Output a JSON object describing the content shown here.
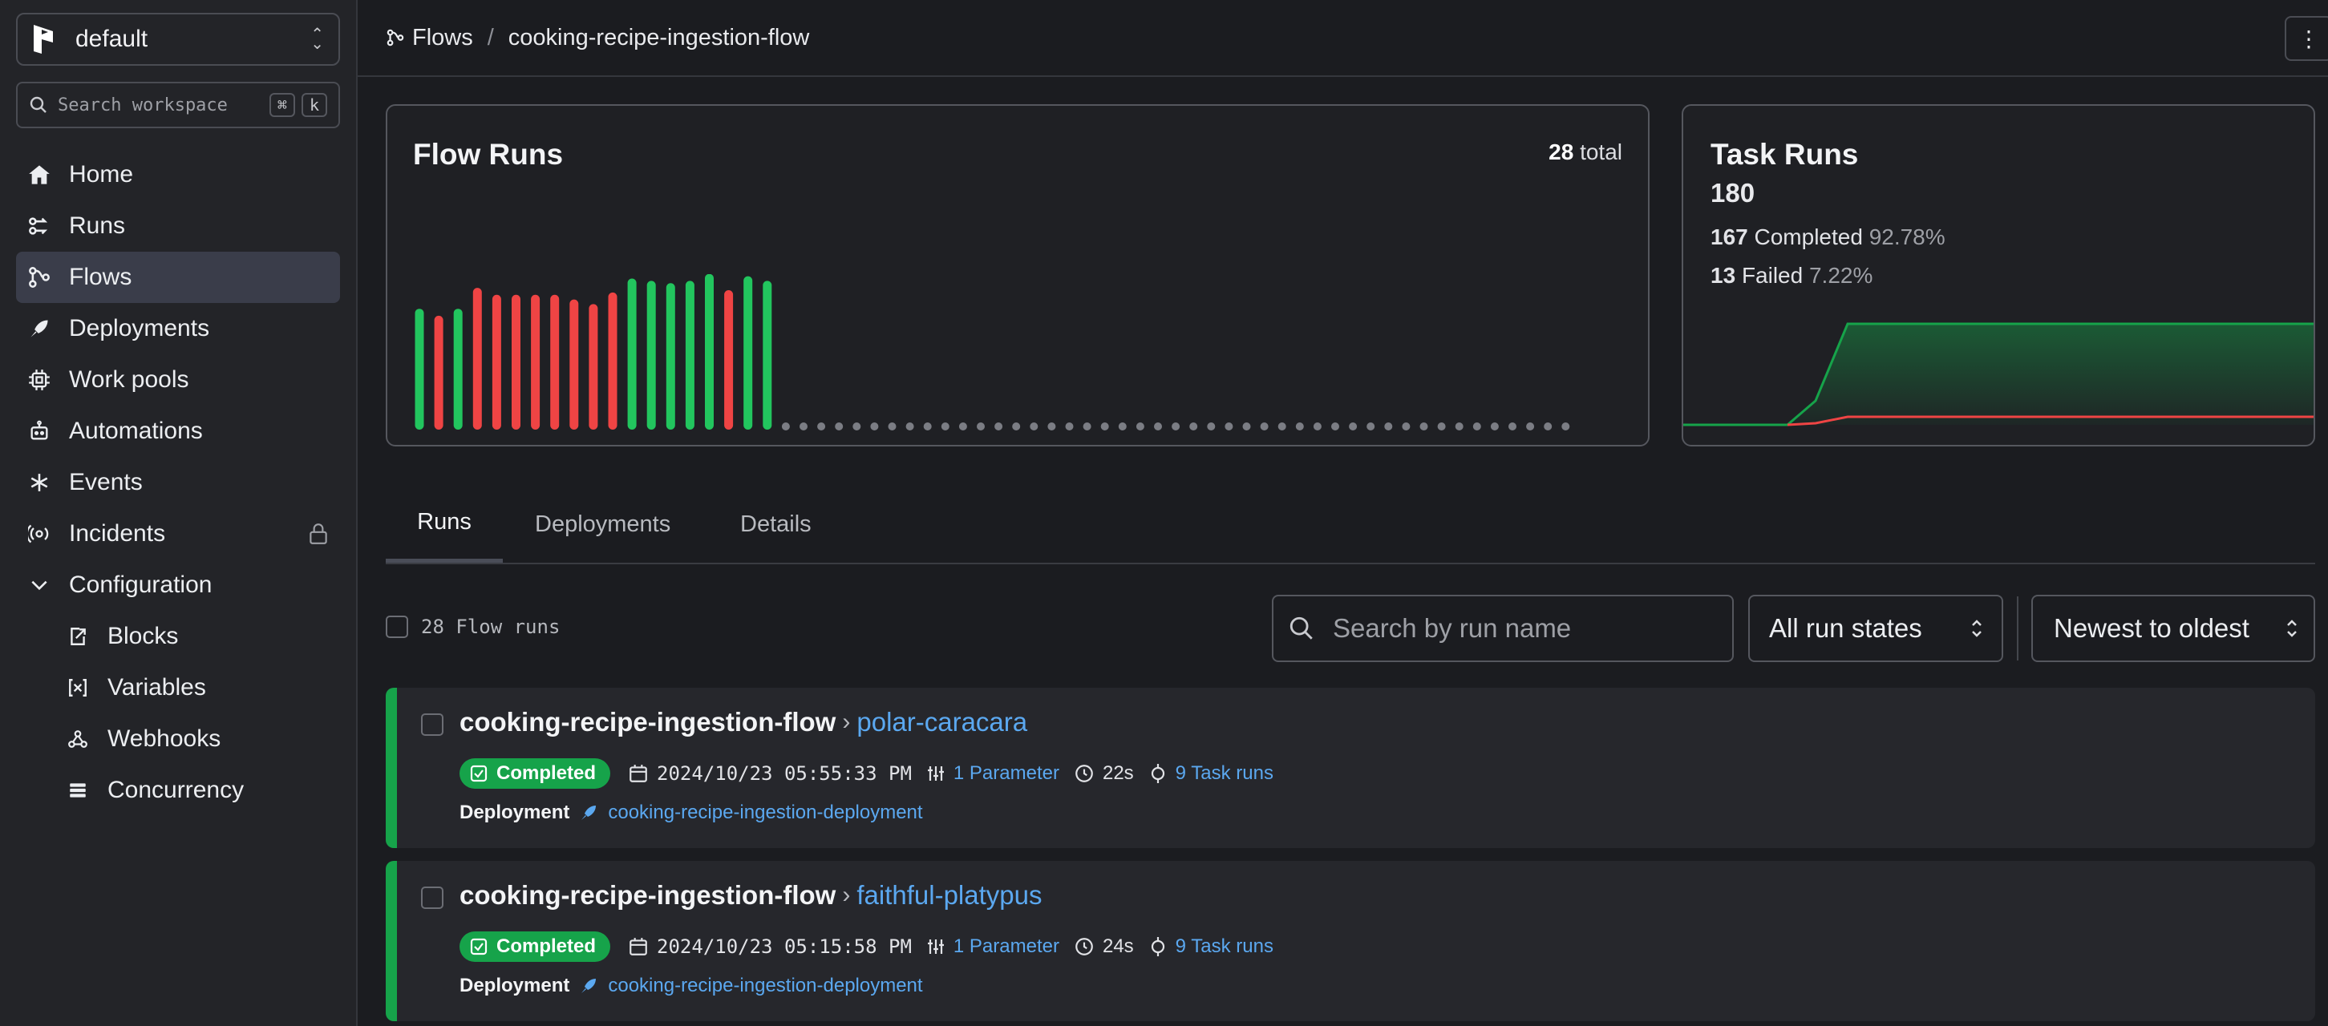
{
  "workspace": {
    "name": "default"
  },
  "search_workspace": {
    "placeholder": "Search workspace",
    "key1": "⌘",
    "key2": "k"
  },
  "nav": {
    "home": "Home",
    "runs": "Runs",
    "flows": "Flows",
    "deployments": "Deployments",
    "work_pools": "Work pools",
    "automations": "Automations",
    "events": "Events",
    "incidents": "Incidents",
    "configuration": "Configuration",
    "blocks": "Blocks",
    "variables": "Variables",
    "webhooks": "Webhooks",
    "concurrency": "Concurrency"
  },
  "breadcrumb": {
    "root": "Flows",
    "sep": "/",
    "current": "cooking-recipe-ingestion-flow"
  },
  "flow_runs_card": {
    "title": "Flow Runs",
    "total_count": "28",
    "total_suffix": "total",
    "bars": [
      {
        "status": "completed",
        "value": 0.52
      },
      {
        "status": "failed",
        "value": 0.49
      },
      {
        "status": "completed",
        "value": 0.52
      },
      {
        "status": "failed",
        "value": 0.61
      },
      {
        "status": "failed",
        "value": 0.58
      },
      {
        "status": "failed",
        "value": 0.58
      },
      {
        "status": "failed",
        "value": 0.58
      },
      {
        "status": "failed",
        "value": 0.58
      },
      {
        "status": "failed",
        "value": 0.56
      },
      {
        "status": "failed",
        "value": 0.54
      },
      {
        "status": "failed",
        "value": 0.59
      },
      {
        "status": "completed",
        "value": 0.65
      },
      {
        "status": "completed",
        "value": 0.64
      },
      {
        "status": "completed",
        "value": 0.63
      },
      {
        "status": "completed",
        "value": 0.64
      },
      {
        "status": "completed",
        "value": 0.67
      },
      {
        "status": "failed",
        "value": 0.6
      },
      {
        "status": "completed",
        "value": 0.66
      },
      {
        "status": "completed",
        "value": 0.64
      }
    ],
    "empty_slots": 45,
    "colors": {
      "completed": "#22c55e",
      "failed": "#ef4444",
      "empty": "#7b7d84"
    }
  },
  "task_runs_card": {
    "title": "Task Runs",
    "total": "180",
    "completed_count": "167",
    "completed_label": "Completed",
    "completed_pct": "92.78%",
    "failed_count": "13",
    "failed_label": "Failed",
    "failed_pct": "7.22%"
  },
  "tabs": [
    "Runs",
    "Deployments",
    "Details"
  ],
  "filters": {
    "count_label": "28 Flow runs",
    "search_placeholder": "Search by run name",
    "state_value": "All run states",
    "sort_value": "Newest to oldest"
  },
  "runs": [
    {
      "flow": "cooking-recipe-ingestion-flow",
      "name": "polar-caracara",
      "state": "Completed",
      "timestamp": "2024/10/23 05:55:33 PM",
      "parameters": "1 Parameter",
      "duration": "22s",
      "task_runs": "9 Task runs",
      "deployment_label": "Deployment",
      "deployment": "cooking-recipe-ingestion-deployment"
    },
    {
      "flow": "cooking-recipe-ingestion-flow",
      "name": "faithful-platypus",
      "state": "Completed",
      "timestamp": "2024/10/23 05:15:58 PM",
      "parameters": "1 Parameter",
      "duration": "24s",
      "task_runs": "9 Task runs",
      "deployment_label": "Deployment",
      "deployment": "cooking-recipe-ingestion-deployment"
    }
  ]
}
